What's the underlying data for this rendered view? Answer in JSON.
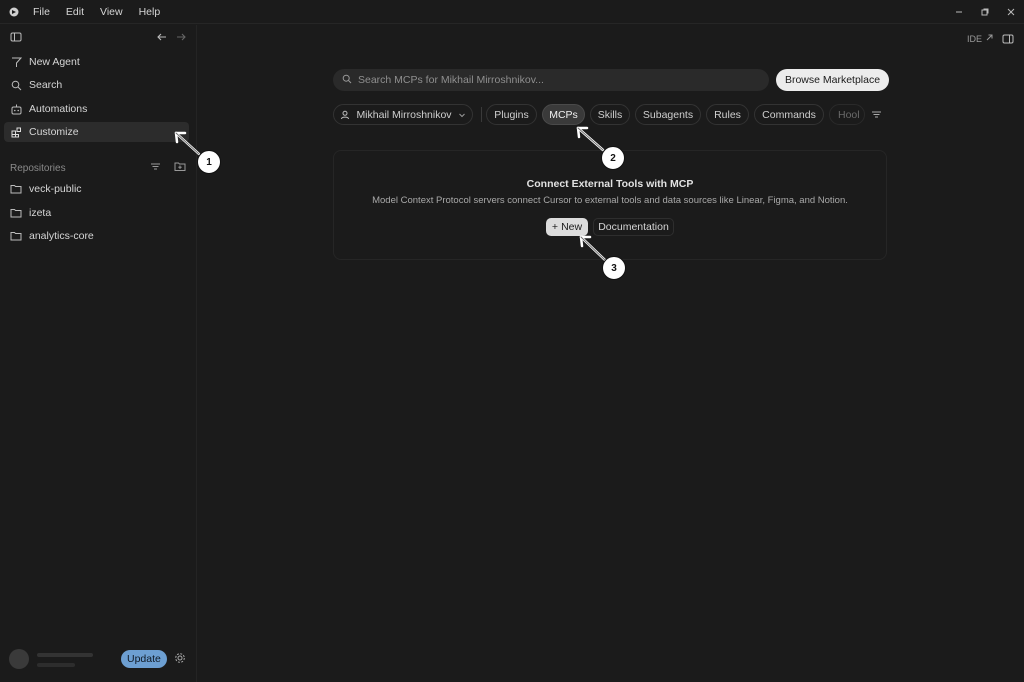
{
  "menu": [
    "File",
    "Edit",
    "View",
    "Help"
  ],
  "sidebar": {
    "items": [
      {
        "label": "New Agent",
        "icon": "new-agent-icon"
      },
      {
        "label": "Search",
        "icon": "search-icon"
      },
      {
        "label": "Automations",
        "icon": "automations-icon"
      },
      {
        "label": "Customize",
        "icon": "customize-icon",
        "active": true
      }
    ],
    "repositories_label": "Repositories",
    "repositories": [
      "veck-public",
      "izeta",
      "analytics-core"
    ],
    "update_label": "Update"
  },
  "main": {
    "ide_label": "IDE",
    "search_placeholder": "Search MCPs for Mikhail Mirroshnikov...",
    "marketplace_label": "Browse Marketplace",
    "user_chip": "Mikhail Mirroshnikov",
    "tabs": [
      "Plugins",
      "MCPs",
      "Skills",
      "Subagents",
      "Rules",
      "Commands",
      "Hool"
    ],
    "active_tab": "MCPs",
    "card": {
      "title": "Connect External Tools with MCP",
      "description": "Model Context Protocol servers connect Cursor to external tools and data sources like Linear, Figma, and Notion.",
      "new_label": "New",
      "doc_label": "Documentation"
    }
  },
  "callouts": [
    "1",
    "2",
    "3"
  ],
  "colors": {
    "background": "#1b1b1b",
    "update_button": "#6d9fd2",
    "active_chip": "#3a3a3a"
  }
}
